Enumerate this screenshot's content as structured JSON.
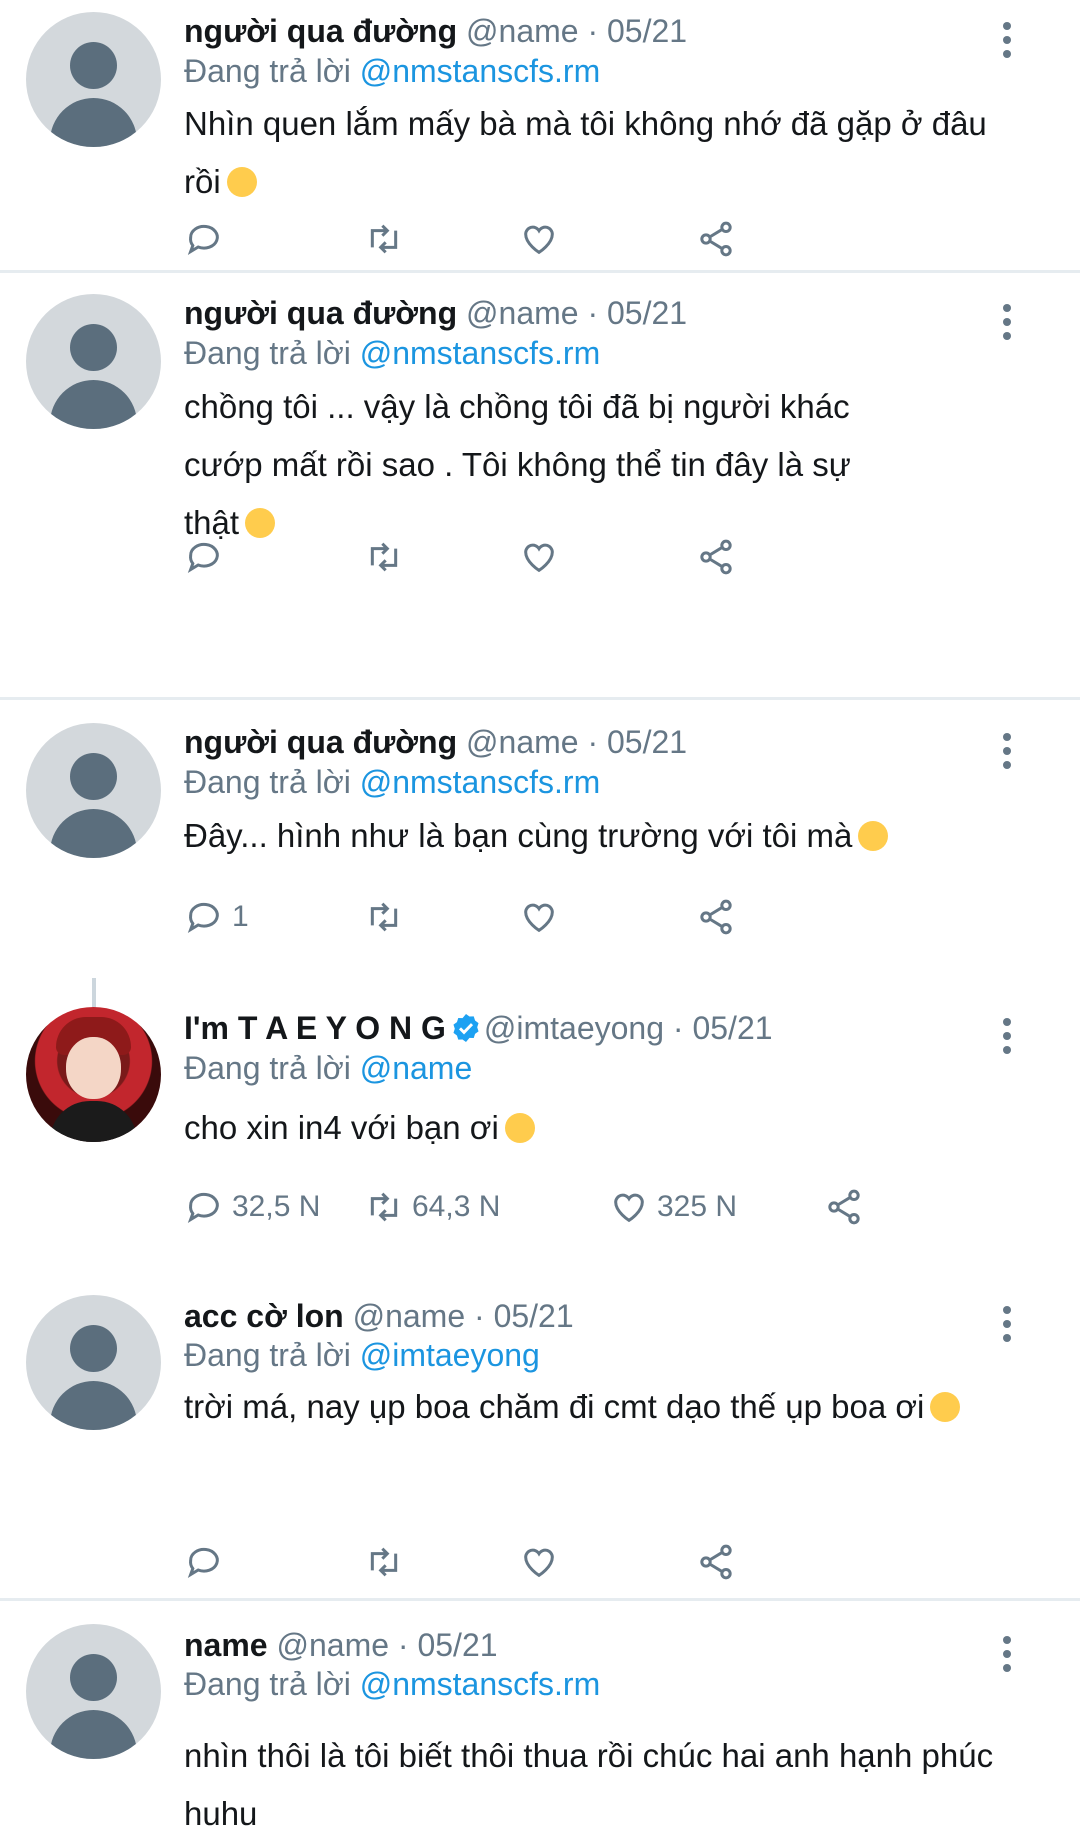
{
  "tweets": [
    {
      "name": "người qua đường",
      "handle": "@name",
      "date": "· 05/21",
      "reply_prefix": "Đang trả lời",
      "reply_to": "@nmstanscfs.rm",
      "text": "Nhìn quen lắm mấy bà mà tôi không nhớ đã gặp ở đâu rồi",
      "replies": "",
      "retweets": "",
      "likes": ""
    },
    {
      "name": "người qua đường",
      "handle": "@name",
      "date": "· 05/21",
      "reply_prefix": "Đang trả lời",
      "reply_to": "@nmstanscfs.rm",
      "text": "chồng tôi ... vậy là chồng tôi đã bị người khác cướp mất  rồi sao . Tôi không thể tin đây là sự thật",
      "replies": "",
      "retweets": "",
      "likes": ""
    },
    {
      "name": "người qua đường",
      "handle": "@name",
      "date": "· 05/21",
      "reply_prefix": "Đang trả lời",
      "reply_to": "@nmstanscfs.rm",
      "text": "Đây... hình như là bạn cùng trường với tôi mà",
      "replies": "1",
      "retweets": "",
      "likes": ""
    },
    {
      "name": "I'm T A E Y O N G",
      "handle": "@imtaeyong",
      "date": "· 05/21",
      "reply_prefix": "Đang trả lời",
      "reply_to": "@name",
      "text": "cho xin in4 với bạn ơi",
      "replies": "32,5 N",
      "retweets": "64,3 N",
      "likes": "325 N"
    },
    {
      "name": "acc cờ lon",
      "handle": "@name",
      "date": "· 05/21",
      "reply_prefix": "Đang trả lời",
      "reply_to": "@imtaeyong",
      "text": "trời má, nay ụp boa chăm đi cmt dạo thế ụp boa ơi",
      "replies": "",
      "retweets": "",
      "likes": ""
    },
    {
      "name": "name",
      "handle": "@name",
      "date": "· 05/21",
      "reply_prefix": "Đang trả lời",
      "reply_to": "@nmstanscfs.rm",
      "text": "nhìn thôi là tôi biết thôi thua rồi    chúc hai anh hạnh phúc huhu",
      "replies": "",
      "retweets": "",
      "likes": ""
    }
  ],
  "icons": {
    "reply": "reply-icon",
    "retweet": "retweet-icon",
    "like": "heart-icon",
    "share": "share-icon",
    "more": "more-vertical-icon",
    "verified": "verified-badge-icon"
  },
  "colors": {
    "mention": "#1b95e0",
    "secondary": "#657786",
    "separator": "#e6ecf0",
    "verified": "#1da1f2"
  }
}
